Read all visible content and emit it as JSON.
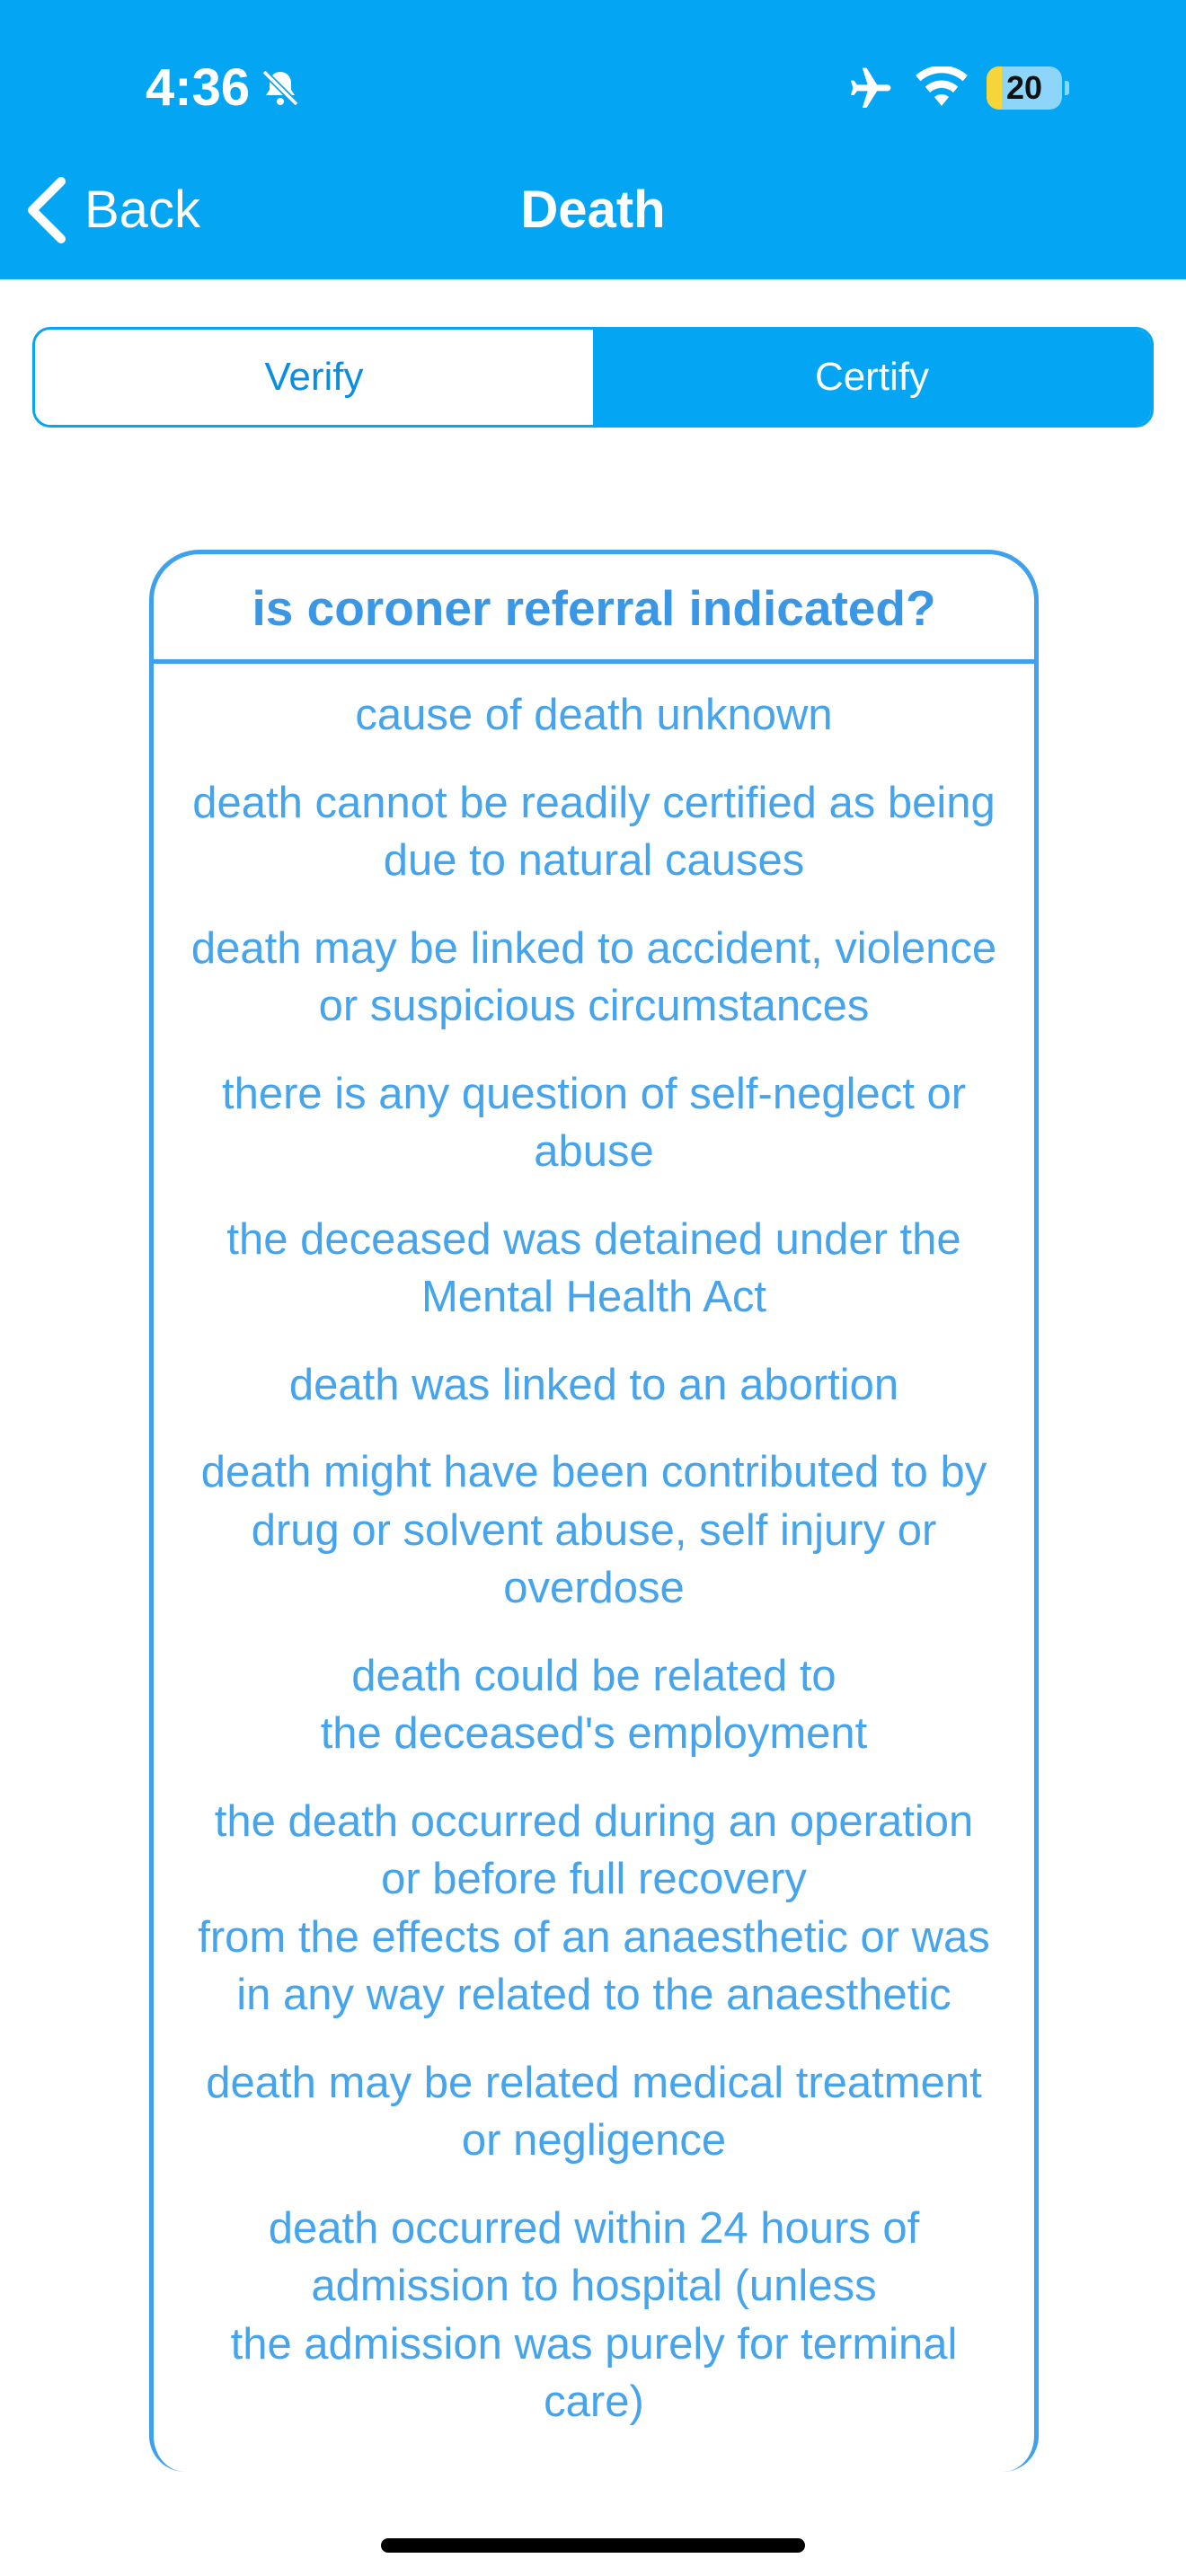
{
  "status_bar": {
    "time": "4:36",
    "battery_level": "20",
    "battery_fraction": 0.2,
    "icons": [
      "bell-slash-icon",
      "airplane-icon",
      "wifi-icon",
      "battery-icon"
    ]
  },
  "nav": {
    "back_label": "Back",
    "title": "Death",
    "back_icon": "chevron-left-icon"
  },
  "tabs": [
    {
      "label": "Verify",
      "selected": false
    },
    {
      "label": "Certify",
      "selected": true
    }
  ],
  "card": {
    "title": "is coroner referral indicated?",
    "items": [
      "cause of death unknown",
      "death cannot be readily certified as being\ndue to natural causes",
      "death may be linked to accident, violence\nor suspicious circumstances",
      "there is any question of self-neglect or\nabuse",
      "the deceased was detained under the\nMental Health Act",
      "death was linked to an abortion",
      "death might have been contributed to by\ndrug or solvent abuse, self injury or\noverdose",
      "death could be related to\nthe deceased's employment",
      "the death occurred during an operation\nor before full recovery\nfrom the effects of an anaesthetic or was\nin any way related to the anaesthetic",
      "death may be related medical treatment\nor negligence",
      "death occurred within 24 hours of\nadmission to hospital (unless\nthe admission was purely for terminal\ncare)"
    ]
  },
  "colors": {
    "brand": "#04A5F3",
    "card_text": "#45A4EB",
    "card_border": "#3FA0EC",
    "battery_fill": "#F6D53A"
  }
}
